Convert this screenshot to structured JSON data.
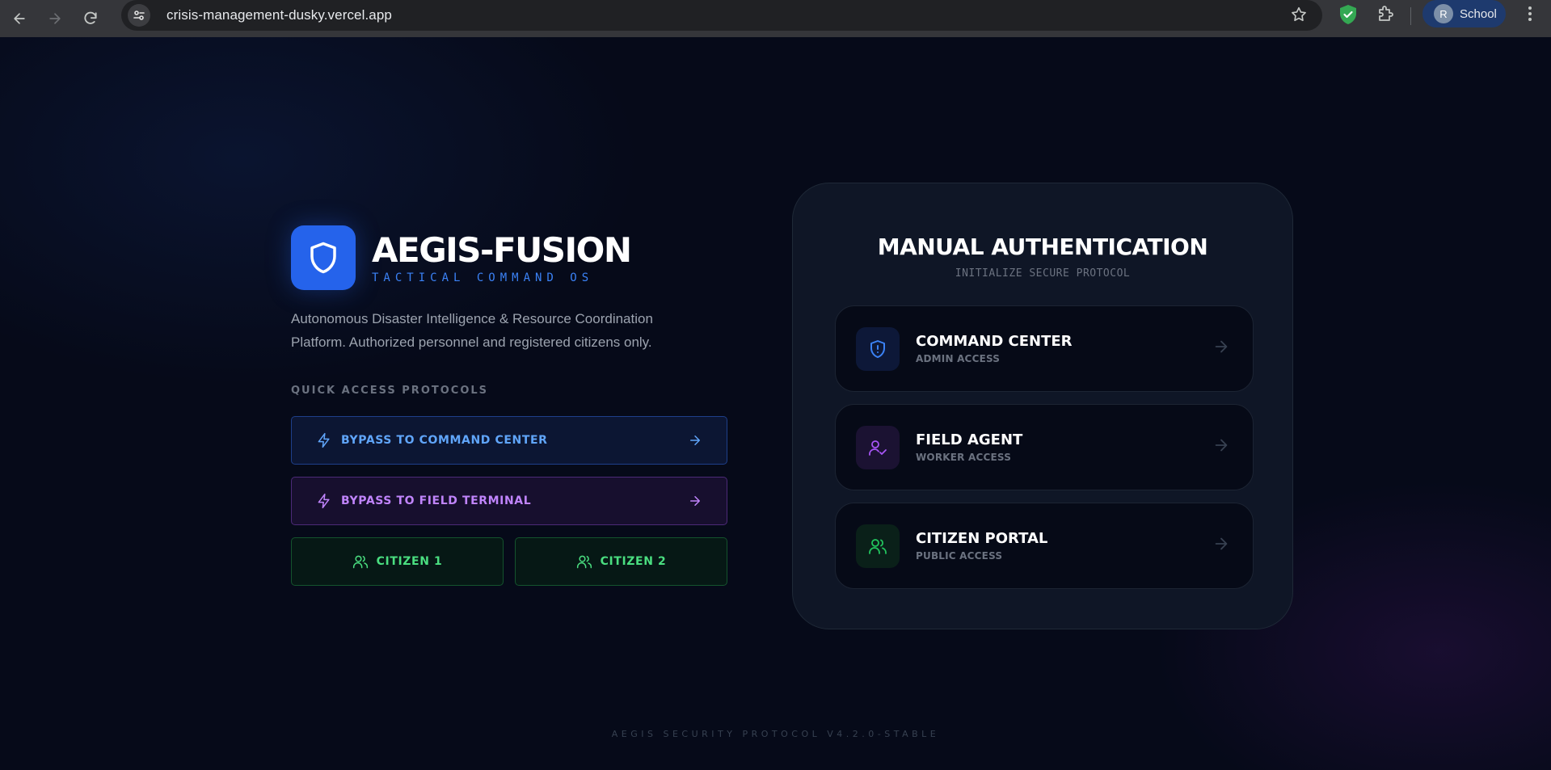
{
  "browser": {
    "url": "crisis-management-dusky.vercel.app",
    "profile_initial": "R",
    "profile_name": "School"
  },
  "brand": {
    "title": "AEGIS-FUSION",
    "subtitle": "TACTICAL COMMAND OS",
    "description": "Autonomous Disaster Intelligence & Resource Coordination Platform. Authorized personnel and registered citizens only."
  },
  "quick_access": {
    "label": "QUICK ACCESS PROTOCOLS",
    "bypass_command": "BYPASS TO COMMAND CENTER",
    "bypass_field": "BYPASS TO FIELD TERMINAL",
    "citizen_1": "CITIZEN 1",
    "citizen_2": "CITIZEN 2"
  },
  "auth": {
    "title": "MANUAL AUTHENTICATION",
    "subtitle": "INITIALIZE SECURE PROTOCOL",
    "roles": [
      {
        "name": "COMMAND CENTER",
        "access": "ADMIN ACCESS",
        "icon": "shield-alert-icon",
        "color": "#3b82f6"
      },
      {
        "name": "FIELD AGENT",
        "access": "WORKER ACCESS",
        "icon": "user-check-icon",
        "color": "#a855f7"
      },
      {
        "name": "CITIZEN PORTAL",
        "access": "PUBLIC ACCESS",
        "icon": "users-icon",
        "color": "#22c55e"
      }
    ]
  },
  "footer": {
    "text": "AEGIS SECURITY PROTOCOL V4.2.0-STABLE"
  },
  "colors": {
    "background": "#060a19",
    "accent_blue": "#2563eb",
    "accent_purple": "#c084fc",
    "accent_green": "#4ade80"
  }
}
